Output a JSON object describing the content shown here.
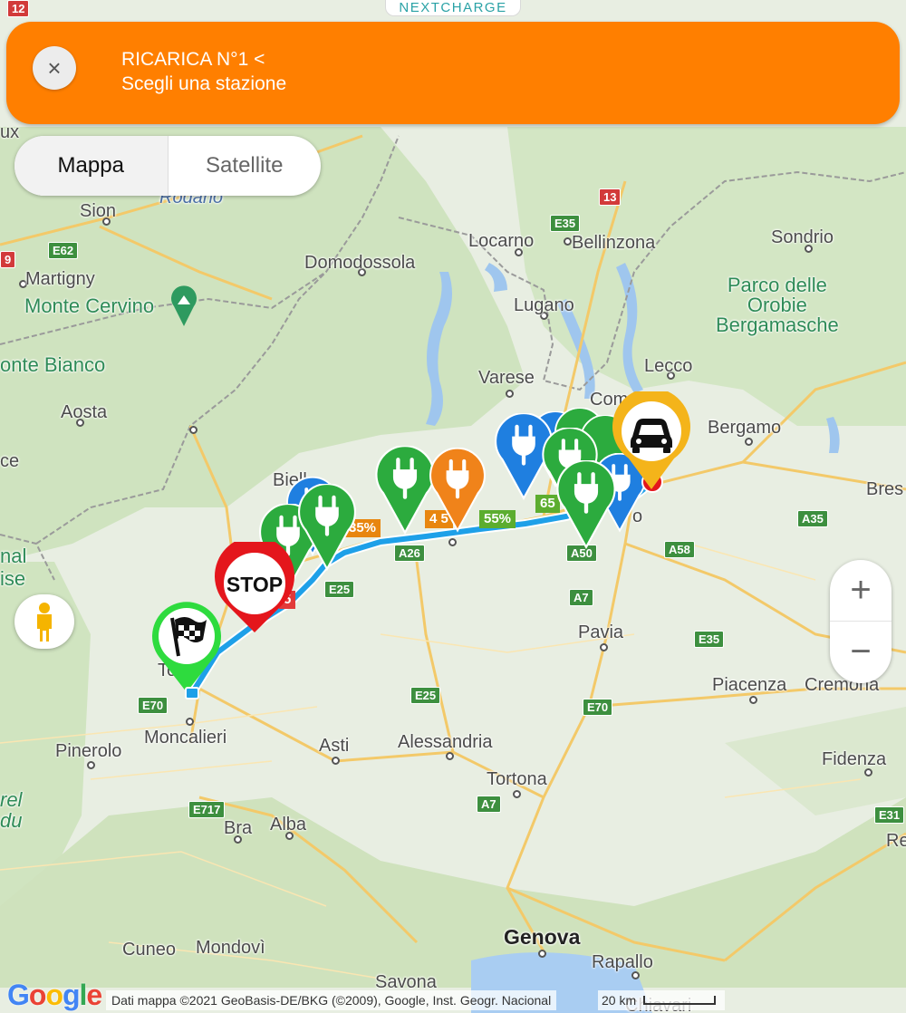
{
  "brand": "NEXTCHARGE",
  "banner": {
    "title": "RICARICA N°1 <",
    "subtitle": "Scegli una stazione",
    "close_icon": "×",
    "color": "#ff7f00"
  },
  "map_type": {
    "map_label": "Mappa",
    "satellite_label": "Satellite",
    "selected": "Mappa"
  },
  "zoom": {
    "in_label": "+",
    "out_label": "−"
  },
  "attribution": {
    "logo": [
      "G",
      "o",
      "o",
      "g",
      "l",
      "e"
    ],
    "text": "Dati mappa ©2021 GeoBasis-DE/BKG (©2009), Google, Inst. Geogr. Nacional",
    "scale": "20 km"
  },
  "places": {
    "sion": "Sion",
    "martigny": "Martigny",
    "monte_cervino": "Monte Cervino",
    "monte_bianco": "onte Bianco",
    "aosta": "Aosta",
    "domodossola": "Domodossola",
    "locarno": "Locarno",
    "bellinzona": "Bellinzona",
    "lugano": "Lugano",
    "sondrio": "Sondrio",
    "orobie_1": "Parco delle",
    "orobie_2": "Orobie",
    "orobie_3": "Bergamasche",
    "varese": "Varese",
    "lecco": "Lecco",
    "como": "Com",
    "bergamo": "Bergamo",
    "bres": "Bres",
    "biella": "Biell",
    "pavia": "Pavia",
    "piacenza": "Piacenza",
    "cremona": "Cremona",
    "fidenza": "Fidenza",
    "alessandria": "Alessandria",
    "asti": "Asti",
    "tortona": "Tortona",
    "moncalieri": "Moncalieri",
    "pinerolo": "Pinerolo",
    "bra": "Bra",
    "alba": "Alba",
    "cuneo": "Cuneo",
    "mondovi": "Mondovì",
    "genova": "Genova",
    "rapallo": "Rapallo",
    "savona": "Savona",
    "chiavari": "Chiavari",
    "torino": "To",
    "milano": "o",
    "re": "Re",
    "rodano": "Rodano",
    "left_frag_1": "ux",
    "left_frag_2": "ce",
    "left_frag_3": "nal",
    "left_frag_4": "ise",
    "left_frag_5": "rel",
    "left_frag_6": "du"
  },
  "roads": {
    "e62": "E62",
    "e35_n": "E35",
    "e25_1": "E25",
    "e25_2": "E25",
    "a26": "A26",
    "a50": "A50",
    "a58": "A58",
    "a7_1": "A7",
    "a7_2": "A7",
    "e35_s": "E35",
    "a35": "A35",
    "e70_1": "E70",
    "e70_2": "E70",
    "e717": "E717",
    "e31": "E31",
    "r13": "13",
    "r9": "9",
    "r12": "12"
  },
  "charge_labels": {
    "l55": "55%",
    "l65": "65",
    "l45": "4  5",
    "l35": "35%",
    "lred": "5"
  },
  "markers": {
    "stop_label": "STOP",
    "finish_icon": "checkered-flag-icon",
    "car_icon": "car-icon",
    "station_icon": "plug-icon",
    "green": "#2cab3e",
    "blue": "#1f7fe0",
    "orange": "#f0831a",
    "red": "#e4161c",
    "yellow": "#f4b41a"
  }
}
